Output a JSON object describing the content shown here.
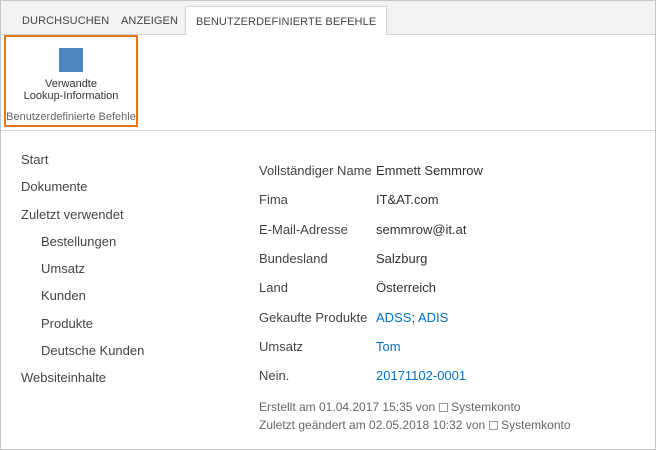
{
  "ribbon": {
    "tabs": [
      {
        "label": "DURCHSUCHEN"
      },
      {
        "label": "ANZEIGEN"
      },
      {
        "label": "BENUTZERDEFINIERTE BEFEHLE"
      }
    ],
    "group": {
      "button_label": "Verwandte\nLookup-Information",
      "label": "Benutzerdefinierte Befehle"
    }
  },
  "nav": {
    "items": [
      {
        "label": "Start"
      },
      {
        "label": "Dokumente"
      },
      {
        "label": "Zuletzt verwendet"
      },
      {
        "label": "Bestellungen"
      },
      {
        "label": "Umsatz"
      },
      {
        "label": "Kunden"
      },
      {
        "label": "Produkte"
      },
      {
        "label": "Deutsche Kunden"
      },
      {
        "label": "Websiteinhalte"
      }
    ]
  },
  "properties": [
    {
      "label": "Vollständiger Name",
      "value": "Emmett Semmrow"
    },
    {
      "label": "Fima",
      "value": "IT&AT.com"
    },
    {
      "label": "E-Mail-Adresse",
      "value": "semmrow@it.at"
    },
    {
      "label": "Bundesland",
      "value": "Salzburg"
    },
    {
      "label": "Land",
      "value": "Österreich"
    },
    {
      "label": "Gekaufte Produkte",
      "link1": "ADSS",
      "sep": ";",
      "link2": "ADIS"
    },
    {
      "label": "Umsatz",
      "value": "Tom"
    },
    {
      "label": "Nein.",
      "value": "20171102-0001"
    }
  ],
  "meta": {
    "created_prefix": "Erstellt am 01.04.2017 15:35  von",
    "created_by": "Systemkonto",
    "modified_prefix": "Zuletzt geändert am 02.05.2018 10:32  von",
    "modified_by": "Systemkonto"
  },
  "colors": {
    "accent_border": "#e07a1a",
    "link": "#0072c6",
    "command_icon": "#4f86c1"
  }
}
